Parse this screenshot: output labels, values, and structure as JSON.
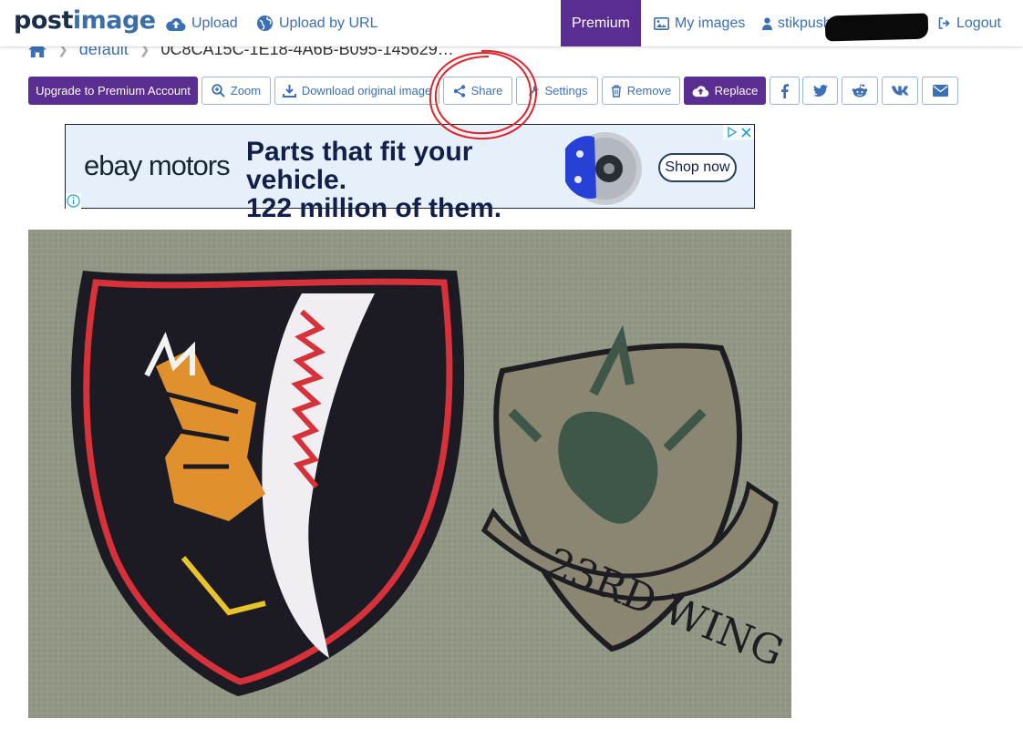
{
  "logo": {
    "part1": "post",
    "part2": "image"
  },
  "nav": {
    "upload": "Upload",
    "upload_url": "Upload by URL",
    "premium": "Premium",
    "my_images": "My images",
    "username": "stikpush",
    "logout": "Logout"
  },
  "breadcrumb": {
    "folder": "default",
    "current": "0C8CA15C-1E18-4A6B-B095-145629…"
  },
  "toolbar": {
    "upgrade": "Upgrade to Premium Account",
    "zoom": "Zoom",
    "download": "Download original image",
    "share": "Share",
    "settings": "Settings",
    "remove": "Remove",
    "replace": "Replace"
  },
  "social": [
    "facebook-icon",
    "twitter-icon",
    "reddit-icon",
    "vk-icon",
    "email-icon"
  ],
  "ad": {
    "brand": "ebay motors",
    "headline_line1": "Parts that fit your vehicle.",
    "headline_line2": "122 million of them.",
    "cta": "Shop now"
  },
  "photo": {
    "patch_right_text": "23RD WING"
  },
  "colors": {
    "brand_purple": "#5a2d91",
    "link_blue": "#3b6fb6",
    "annotation_red": "#e0242a"
  }
}
